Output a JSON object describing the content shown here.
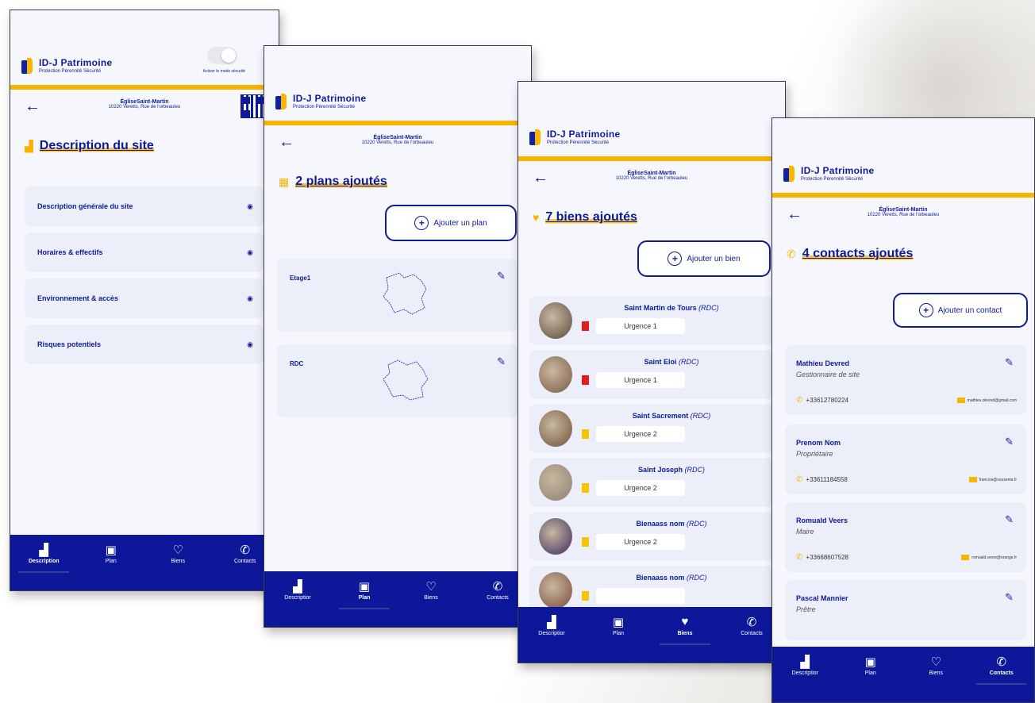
{
  "brand": {
    "title": "ID-J Patrimoine",
    "tagline": "Protection Pérennité Sécurité",
    "colors": {
      "primary": "#0d1799",
      "accent": "#f7b500",
      "card": "#eceef9"
    }
  },
  "site": {
    "name": "ÉgliseSaint-Martin",
    "address": "10220 Veretts, Rue de l'orbeauleu"
  },
  "toggle_label": "Activer le mode sécurité",
  "nav": {
    "description": "Description",
    "description_short": "Descriptior",
    "plan": "Plan",
    "biens": "Biens",
    "contacts": "Contacts"
  },
  "screen1": {
    "title": "Description du site",
    "items": [
      "Description générale du site",
      "Horaires & effectifs",
      "Environnement & accès",
      "Risques potentiels"
    ]
  },
  "screen2": {
    "title": "2 plans ajoutés",
    "add_label": "Ajouter un plan",
    "plans": [
      "Etage1",
      "RDC"
    ]
  },
  "screen3": {
    "title": "7 biens ajoutés",
    "add_label": "Ajouter un bien",
    "biens": [
      {
        "name": "Saint Martin de Tours",
        "level": "(RDC)",
        "urgency": "Urgence 1",
        "color": "#e31c1c",
        "img": "#5b4a3c"
      },
      {
        "name": "Saint Eloi",
        "level": "(RDC)",
        "urgency": "Urgence 1",
        "color": "#e31c1c",
        "img": "#7a5a42"
      },
      {
        "name": "Saint Sacrement",
        "level": "(RDC)",
        "urgency": "Urgence 2",
        "color": "#f7c400",
        "img": "#6e5238"
      },
      {
        "name": "Saint Joseph",
        "level": "(RDC)",
        "urgency": "Urgence 2",
        "color": "#f7c400",
        "img": "#8c8072"
      },
      {
        "name": "Bienaass nom",
        "level": "(RDC)",
        "urgency": "Urgence 2",
        "color": "#f7c400",
        "img": "#3a2a5c"
      },
      {
        "name": "Bienaass nom",
        "level": "(RDC)",
        "urgency": "",
        "color": "#f7c400",
        "img": "#7a4a3a"
      }
    ]
  },
  "screen4": {
    "title": "4 contacts ajoutés",
    "add_label": "Ajouter un contact",
    "contacts": [
      {
        "name": "Mathieu Devred",
        "role": "Gestionnaire de site",
        "phone": "+33612780224",
        "email": "mathieu.devred@gmail.com"
      },
      {
        "name": "Prenom Nom",
        "role": "Propriétaire",
        "phone": "+33611184558",
        "email": "francois@sousente.fr"
      },
      {
        "name": "Romuald Veers",
        "role": "Maire",
        "phone": "+33668607528",
        "email": "romuald.veers@orange.fr"
      },
      {
        "name": "Pascal Mannier",
        "role": "Prêtre",
        "phone": "",
        "email": ""
      }
    ]
  }
}
